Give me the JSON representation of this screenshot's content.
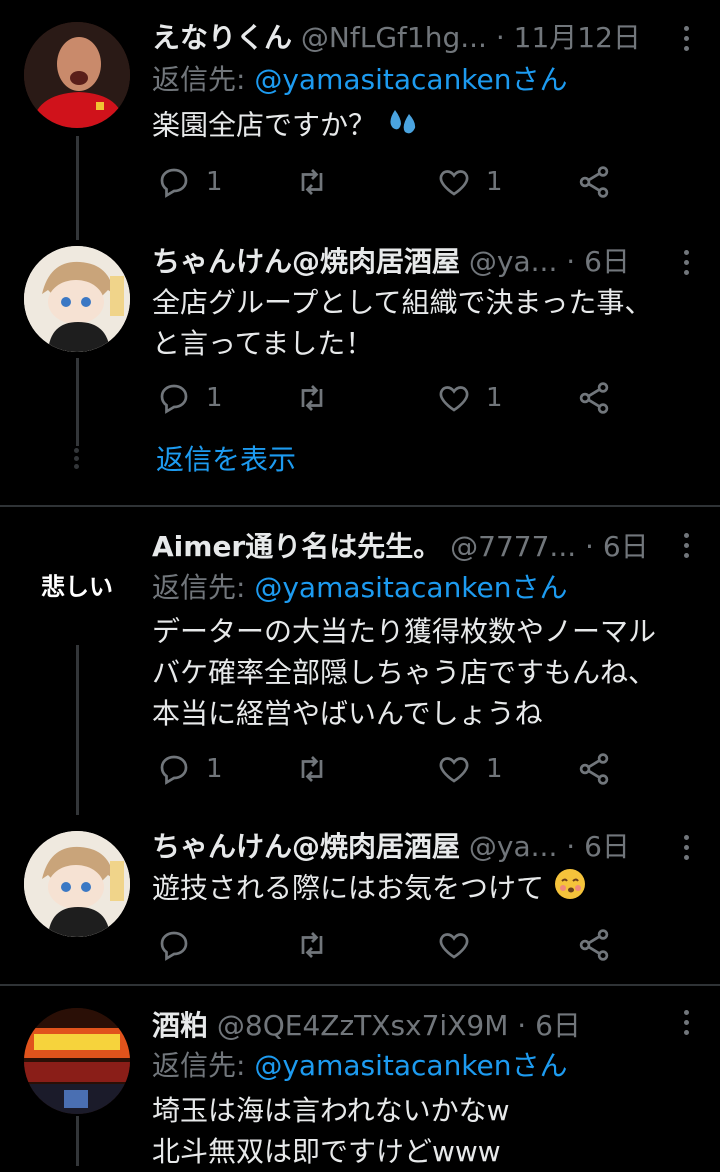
{
  "tweets": [
    {
      "name": "えなりくん",
      "handle": "@NfLGf1hg...",
      "sep": "·",
      "date": "11月12日",
      "reply_prefix": "返信先: ",
      "reply_mention": "@yamasitacanken",
      "reply_suffix": "さん",
      "lines": [
        "楽園全店ですか？"
      ],
      "emoji": "sweat-droplets",
      "reply_count": "1",
      "like_count": "1"
    },
    {
      "name": "ちゃんけん@焼肉居酒屋",
      "handle": "@ya...",
      "sep": "·",
      "date": "6日",
      "lines": [
        "全店グループとして組織で決まった事、",
        "と言ってました！"
      ],
      "reply_count": "1",
      "like_count": "1"
    },
    {
      "name": "Aimer通り名は先生。",
      "handle": "@7777...",
      "sep": "·",
      "date": "6日",
      "avatar_text": "悲しい",
      "reply_prefix": "返信先: ",
      "reply_mention": "@yamasitacanken",
      "reply_suffix": "さん",
      "lines": [
        "データーの大当たり獲得枚数やノーマル",
        "バケ確率全部隠しちゃう店ですもんね、",
        "本当に経営やばいんでしょうね"
      ],
      "reply_count": "1",
      "like_count": "1"
    },
    {
      "name": "ちゃんけん@焼肉居酒屋",
      "handle": "@ya...",
      "sep": "·",
      "date": "6日",
      "lines": [
        "遊技される際にはお気をつけて"
      ],
      "emoji": "face-blowing-kiss",
      "reply_count": "",
      "like_count": ""
    },
    {
      "name": "酒粕",
      "handle": "@8QE4ZzTXsx7iX9M",
      "sep": "·",
      "date": "6日",
      "reply_prefix": "返信先: ",
      "reply_mention": "@yamasitacanken",
      "reply_suffix": "さん",
      "lines": [
        "埼玉は海は言われないかなw",
        "北斗無双は即ですけどwww"
      ]
    }
  ],
  "show_replies": "返信を表示",
  "colors": {
    "background": "#000000",
    "text": "#e7e9ea",
    "muted": "#71767b",
    "link": "#1d9bf0",
    "line": "#333639"
  }
}
